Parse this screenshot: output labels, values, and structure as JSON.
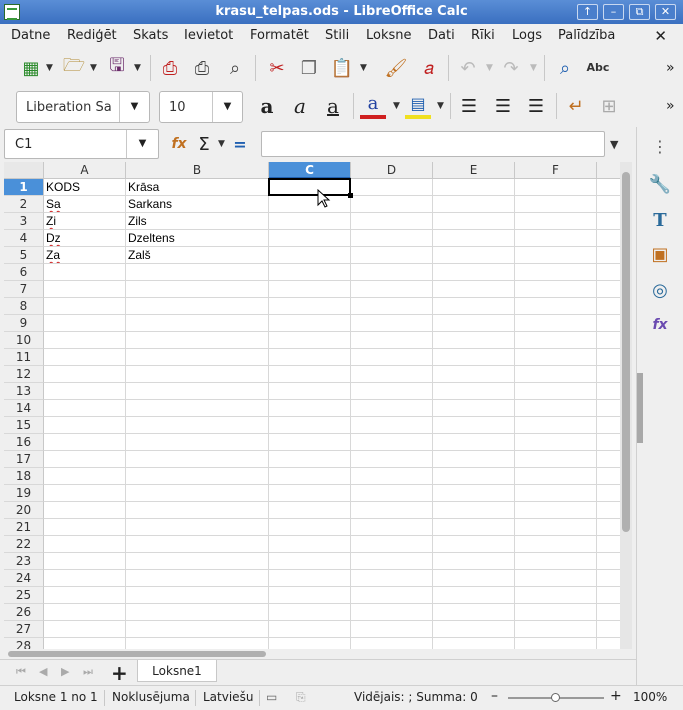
{
  "window": {
    "title": "krasu_telpas.ods - LibreOffice Calc",
    "buttons": [
      "↑",
      "–",
      "⧉",
      "✕"
    ]
  },
  "menu": {
    "items": [
      "Datne",
      "Rediģēt",
      "Skats",
      "Ievietot",
      "Formatēt",
      "Stili",
      "Loksne",
      "Dati",
      "Rīki",
      "Logs",
      "Palīdzība"
    ],
    "close": "✕"
  },
  "toolbar": {
    "font_name": "Liberation Sa",
    "font_size": "10",
    "more": "»"
  },
  "formula_bar": {
    "name_box": "C1",
    "content": ""
  },
  "sheet": {
    "columns": [
      "A",
      "B",
      "C",
      "D",
      "E",
      "F"
    ],
    "selected_column": "C",
    "rows": [
      "1",
      "2",
      "3",
      "4",
      "5",
      "6",
      "7",
      "8",
      "9",
      "10",
      "11",
      "12",
      "13",
      "14",
      "15",
      "16",
      "17",
      "18",
      "19",
      "20",
      "21",
      "22",
      "23",
      "24",
      "25",
      "26",
      "27",
      "28"
    ],
    "selected_row": "1",
    "cells": [
      [
        "KODS",
        "Krāsa"
      ],
      [
        "Sa",
        "Sarkans"
      ],
      [
        "Zi",
        "Zils"
      ],
      [
        "Dz",
        "Dzeltens"
      ],
      [
        "Za",
        "Zalš"
      ]
    ]
  },
  "tabs": {
    "nav": [
      "⏮",
      "◀",
      "▶",
      "⏭"
    ],
    "add": "+",
    "sheets": [
      "Loksne1"
    ]
  },
  "status": {
    "sheet_pos": "Loksne 1 no 1",
    "page_style": "Noklusējuma",
    "language": "Latviešu",
    "summary": "Vidējais: ; Summa: 0",
    "zoom": "100%",
    "zoom_minus": "–",
    "zoom_plus": "+"
  },
  "colors": {
    "selection": "#4a90d9",
    "titlebar": "#3a6fc0"
  }
}
